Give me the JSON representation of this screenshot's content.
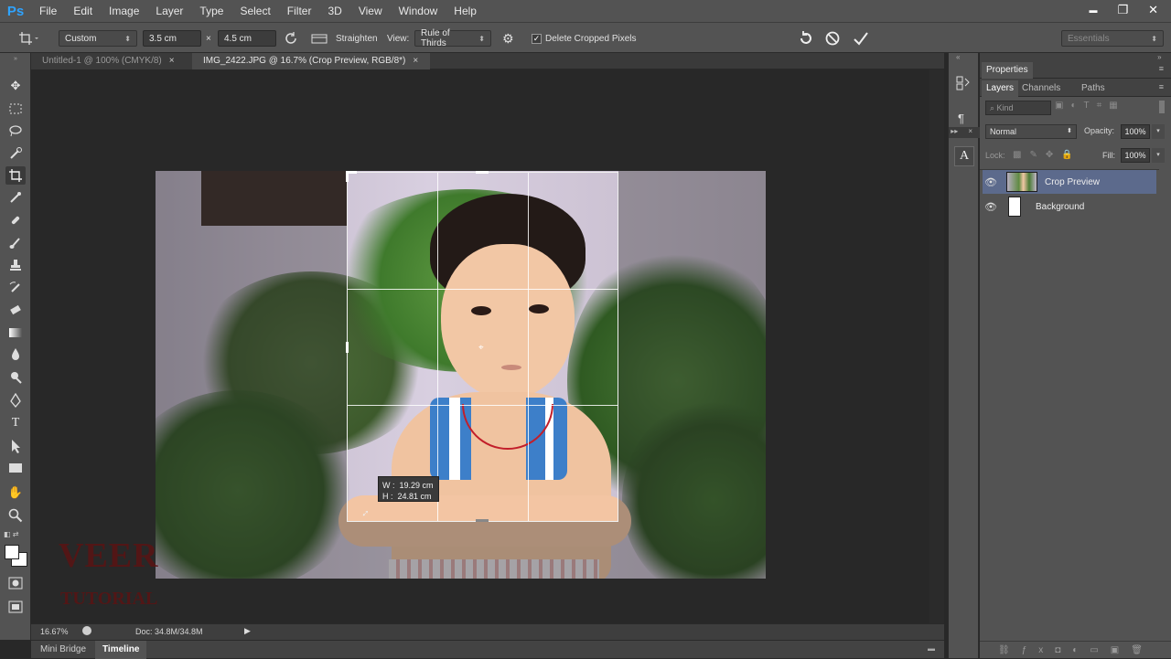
{
  "app": {
    "logo": "Ps"
  },
  "menu": [
    "File",
    "Edit",
    "Image",
    "Layer",
    "Type",
    "Select",
    "Filter",
    "3D",
    "View",
    "Window",
    "Help"
  ],
  "window_controls": {
    "minimize": "▬",
    "restore": "❐",
    "close": "✕"
  },
  "options_bar": {
    "ratio_preset": "Custom",
    "width_value": "3.5 cm",
    "times_symbol": "×",
    "height_value": "4.5 cm",
    "straighten_label": "Straighten",
    "view_label": "View:",
    "view_value": "Rule of Thirds",
    "delete_cropped_label": "Delete Cropped Pixels",
    "delete_cropped_checked": true,
    "workspace_value": "Essentials"
  },
  "tabs": [
    {
      "label": "Untitled-1 @ 100% (CMYK/8)",
      "active": false
    },
    {
      "label": "IMG_2422.JPG @ 16.7% (Crop Preview, RGB/8*)",
      "active": true
    }
  ],
  "crop_tooltip": {
    "w_label": "W :",
    "w_value": "19.29 cm",
    "h_label": "H :",
    "h_value": "24.81 cm"
  },
  "watermark": {
    "line1": "VEER",
    "line2": "TUTORIAL"
  },
  "status": {
    "zoom": "16.67%",
    "doc": "Doc: 34.8M/34.8M"
  },
  "bottom_tabs": [
    "Mini Bridge",
    "Timeline"
  ],
  "panels": {
    "properties_title": "Properties",
    "tabs": [
      "Layers",
      "Channels",
      "Paths"
    ],
    "kind_label": "Kind",
    "blend_mode": "Normal",
    "opacity_label": "Opacity:",
    "opacity_value": "100%",
    "lock_label": "Lock:",
    "fill_label": "Fill:",
    "fill_value": "100%",
    "layers": [
      {
        "name": "Crop Preview",
        "selected": true
      },
      {
        "name": "Background",
        "selected": false
      }
    ]
  },
  "colors": {
    "chrome": "#535353",
    "canvas_bg": "#282828",
    "accent_logo": "#2fa3ff",
    "selection": "#5a6a8a"
  }
}
